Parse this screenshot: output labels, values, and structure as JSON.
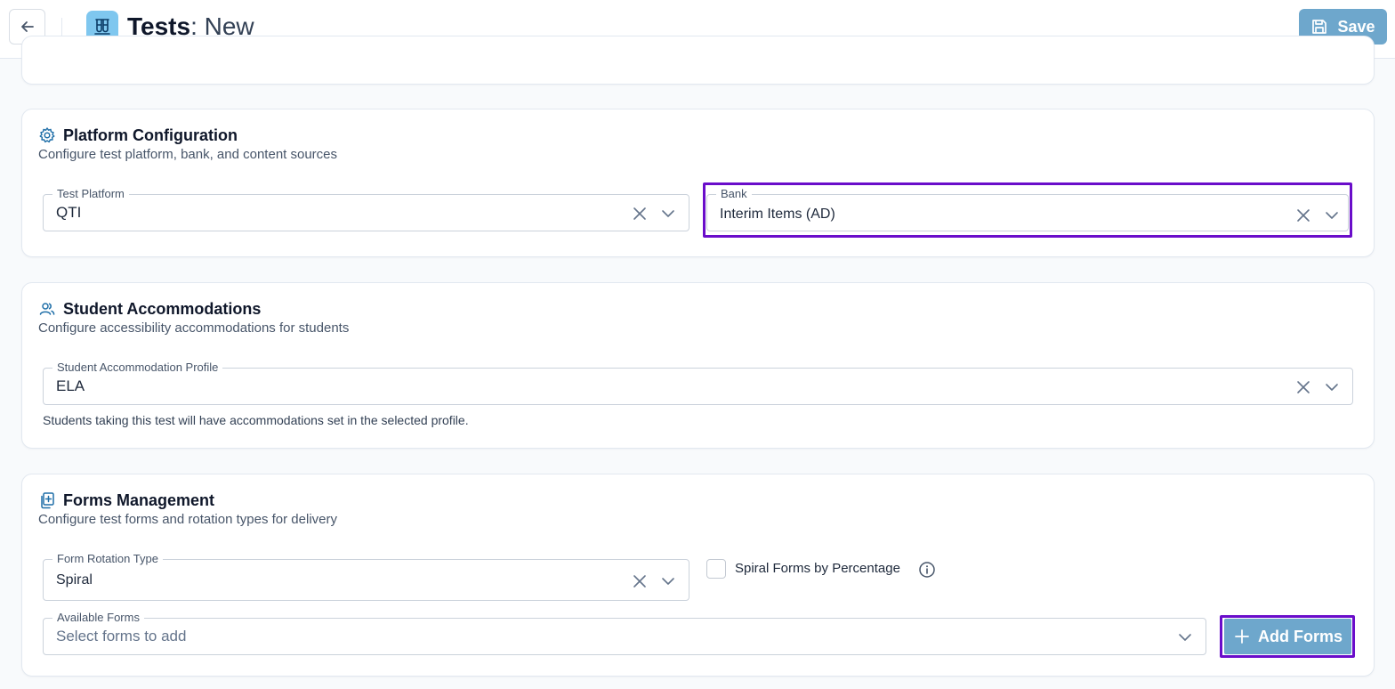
{
  "header": {
    "title_strong": "Tests",
    "title_rest": ": New",
    "save_label": "Save",
    "icons": {
      "back": "arrow-left-icon",
      "app": "test-tubes-icon",
      "save": "floppy-disk-icon"
    }
  },
  "platform_config": {
    "title": "Platform Configuration",
    "subtitle": "Configure test platform, bank, and content sources",
    "icon": "gear-icon",
    "test_platform": {
      "label": "Test Platform",
      "value": "QTI"
    },
    "bank": {
      "label": "Bank",
      "value": "Interim Items (AD)"
    }
  },
  "accommodations": {
    "title": "Student Accommodations",
    "subtitle": "Configure accessibility accommodations for students",
    "icon": "users-icon",
    "profile": {
      "label": "Student Accommodation Profile",
      "value": "ELA"
    },
    "helper": "Students taking this test will have accommodations set in the selected profile."
  },
  "forms": {
    "title": "Forms Management",
    "subtitle": "Configure test forms and rotation types for delivery",
    "icon": "copy-plus-icon",
    "rotation": {
      "label": "Form Rotation Type",
      "value": "Spiral"
    },
    "spiral_checkbox": {
      "label": "Spiral Forms by Percentage",
      "checked": false
    },
    "available": {
      "label": "Available Forms",
      "placeholder": "Select forms to add"
    },
    "add_label": "Add Forms"
  },
  "colors": {
    "accent": "#6ea7cc",
    "highlight": "#6a0dca",
    "icon_blue": "#1f6fa8"
  }
}
